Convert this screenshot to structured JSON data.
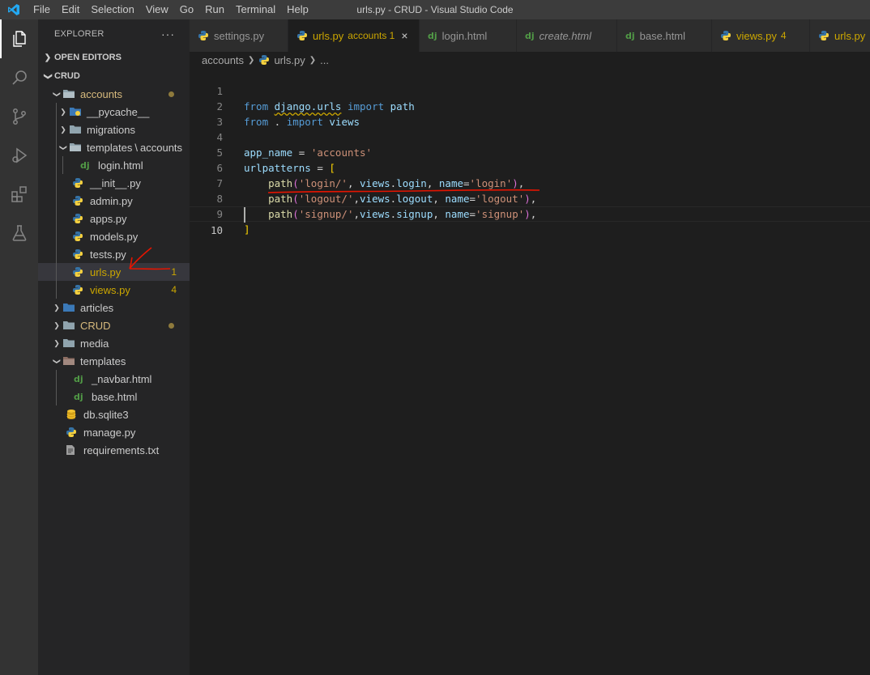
{
  "window": {
    "title": "urls.py - CRUD - Visual Studio Code",
    "menu": [
      "File",
      "Edit",
      "Selection",
      "View",
      "Go",
      "Run",
      "Terminal",
      "Help"
    ]
  },
  "activity_bar": {
    "items": [
      "explorer-icon",
      "search-icon",
      "source-control-icon",
      "run-debug-icon",
      "extensions-icon",
      "testing-icon"
    ],
    "active": "explorer-icon"
  },
  "sidebar": {
    "title": "EXPLORER",
    "more": "···",
    "open_editors": "OPEN EDITORS",
    "root": "CRUD",
    "tree": [
      {
        "label": "accounts",
        "kind": "folder-open",
        "status": "modified-dot"
      },
      {
        "label": "__pycache__",
        "kind": "folder"
      },
      {
        "label": "migrations",
        "kind": "folder"
      },
      {
        "label": "templates",
        "sep": "\\",
        "label2": "accounts",
        "kind": "folder-open"
      },
      {
        "label": "login.html",
        "kind": "django"
      },
      {
        "label": "__init__.py",
        "kind": "python"
      },
      {
        "label": "admin.py",
        "kind": "python"
      },
      {
        "label": "apps.py",
        "kind": "python"
      },
      {
        "label": "models.py",
        "kind": "python"
      },
      {
        "label": "tests.py",
        "kind": "python"
      },
      {
        "label": "urls.py",
        "kind": "python",
        "badge": "1",
        "selected": true
      },
      {
        "label": "views.py",
        "kind": "python",
        "badge": "4"
      },
      {
        "label": "articles",
        "kind": "folder"
      },
      {
        "label": "CRUD",
        "kind": "folder",
        "status": "modified-dot"
      },
      {
        "label": "media",
        "kind": "folder"
      },
      {
        "label": "templates",
        "kind": "folder-open"
      },
      {
        "label": "_navbar.html",
        "kind": "django"
      },
      {
        "label": "base.html",
        "kind": "django"
      },
      {
        "label": "db.sqlite3",
        "kind": "database"
      },
      {
        "label": "manage.py",
        "kind": "python"
      },
      {
        "label": "requirements.txt",
        "kind": "text"
      }
    ]
  },
  "tabs": [
    {
      "label": "settings.py",
      "kind": "python"
    },
    {
      "label": "urls.py",
      "desc": "accounts 1",
      "kind": "python",
      "active": true,
      "close": "×"
    },
    {
      "label": "login.html",
      "kind": "django"
    },
    {
      "label": "create.html",
      "kind": "django",
      "italic": true
    },
    {
      "label": "base.html",
      "kind": "django"
    },
    {
      "label": "views.py",
      "desc": "4",
      "kind": "python"
    },
    {
      "label": "urls.py",
      "kind": "python"
    }
  ],
  "breadcrumbs": [
    "accounts",
    "urls.py",
    "..."
  ],
  "editor": {
    "line_numbers": [
      "1",
      "2",
      "3",
      "4",
      "5",
      "6",
      "7",
      "8",
      "9",
      "10"
    ],
    "current_line": 10,
    "lines": [
      "from django.urls import path",
      "from . import views",
      "",
      "app_name = 'accounts'",
      "urlpatterns = [",
      "    path('login/', views.login, name='login'),",
      "    path('logout/',views.logout, name='logout'),",
      "    path('signup/',views.signup, name='signup'),",
      "]",
      ""
    ]
  },
  "colors": {
    "keyword": "#569cd6",
    "string": "#ce9178",
    "variable": "#9cdcfe",
    "function": "#dcdcaa",
    "warning": "#cca700",
    "annotation": "#e51400"
  }
}
